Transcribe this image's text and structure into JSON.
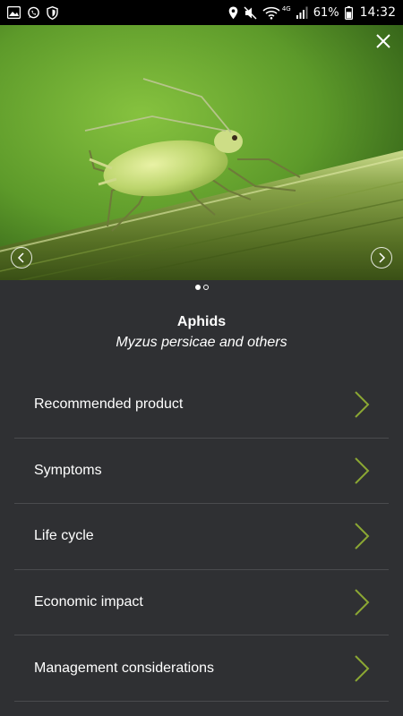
{
  "status_bar": {
    "left_icons": [
      "image-icon",
      "whatsapp-icon",
      "shield-icon"
    ],
    "right_icons": [
      "location-icon",
      "mute-icon",
      "wifi-icon",
      "signal-icon",
      "battery-icon"
    ],
    "network": "4G",
    "battery": "61%",
    "time": "14:32"
  },
  "hero": {
    "image_subject": "aphid on green stem",
    "slide_count": 2,
    "active_slide": 1
  },
  "pest": {
    "name": "Aphids",
    "scientific_name": "Myzus persicae and others"
  },
  "menu": {
    "items": [
      {
        "label": "Recommended product"
      },
      {
        "label": "Symptoms"
      },
      {
        "label": "Life cycle"
      },
      {
        "label": "Economic impact"
      },
      {
        "label": "Management considerations"
      }
    ]
  },
  "colors": {
    "background": "#2f3033",
    "divider": "#4a4b4e",
    "accent_chevron": "#8ba733",
    "status_bar": "#000000"
  }
}
